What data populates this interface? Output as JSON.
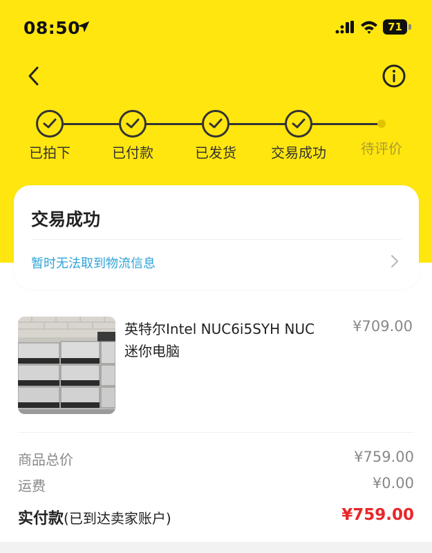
{
  "status_bar": {
    "time": "08:50",
    "battery": "71",
    "icons": [
      "location-arrow-icon",
      "cellular-signal-icon",
      "wifi-icon",
      "battery-icon"
    ]
  },
  "header": {
    "back_icon": "chevron-left-icon",
    "info_icon": "info-circle-icon",
    "background_color": "#FFE60F"
  },
  "progress": {
    "steps": [
      {
        "label": "已拍下",
        "done": true
      },
      {
        "label": "已付款",
        "done": true
      },
      {
        "label": "已发货",
        "done": true
      },
      {
        "label": "交易成功",
        "done": true
      },
      {
        "label": "待评价",
        "done": false
      }
    ]
  },
  "status_card": {
    "title": "交易成功",
    "logistics_text": "暂时无法取到物流信息",
    "logistics_color": "#2FA3D6"
  },
  "product": {
    "title": "英特尔Intel NUC6i5SYH NUC 迷你电脑",
    "price": "¥709.00",
    "image": "product-photo"
  },
  "summary": {
    "goods_total_label": "商品总价",
    "goods_total_value": "¥759.00",
    "shipping_label": "运费",
    "shipping_value": "¥0.00",
    "paid_label": "实付款",
    "paid_note": "(已到达卖家账户)",
    "paid_value": "¥759.00",
    "paid_color": "#E8262A"
  }
}
